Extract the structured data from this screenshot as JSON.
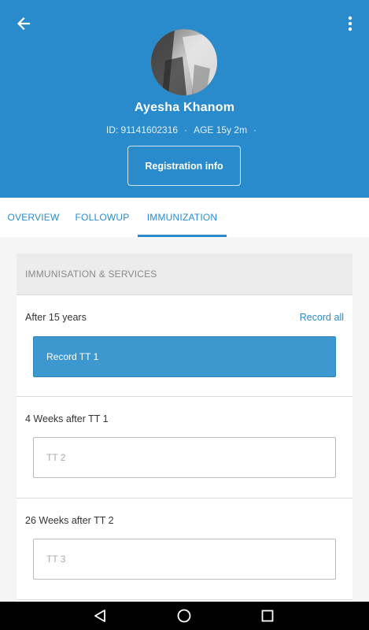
{
  "header": {
    "client_name": "Ayesha Khanom",
    "id_label": "ID: 91141602316",
    "age_label": "AGE 15y 2m",
    "separator": "·",
    "registration_button": "Registration info",
    "background_color": "#2a8bcc"
  },
  "tabs": [
    {
      "label": "OVERVIEW",
      "active": false
    },
    {
      "label": "FOLLOWUP",
      "active": false
    },
    {
      "label": "IMMUNIZATION",
      "active": true
    }
  ],
  "card": {
    "header": "IMMUNISATION & SERVICES",
    "groups": [
      {
        "title": "After 15 years",
        "action": "Record all",
        "button": "Record TT 1"
      },
      {
        "title": "4 Weeks after TT 1",
        "button": "TT 2"
      },
      {
        "title": "26 Weeks after TT 2",
        "button": "TT 3"
      }
    ]
  },
  "icons": {
    "back": "arrow-left-icon",
    "overflow": "more-vertical-icon",
    "nav_back": "triangle-back-icon",
    "nav_home": "circle-home-icon",
    "nav_recents": "square-recents-icon"
  }
}
